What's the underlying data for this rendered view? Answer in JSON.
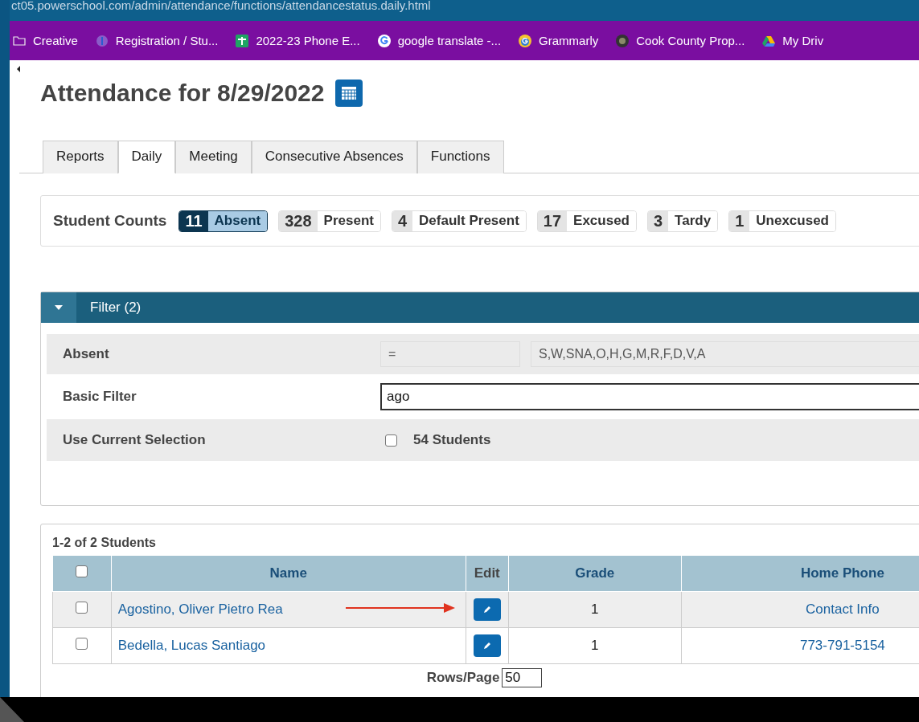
{
  "browser": {
    "url": "ct05.powerschool.com/admin/attendance/functions/attendancestatus.daily.html",
    "bookmarks": [
      {
        "label": "Creative",
        "kind": "folder"
      },
      {
        "label": "Registration / Stu...",
        "kind": "info"
      },
      {
        "label": "2022-23 Phone E...",
        "kind": "sheet"
      },
      {
        "label": "google translate -...",
        "kind": "google"
      },
      {
        "label": "Grammarly",
        "kind": "grammarly"
      },
      {
        "label": "Cook County Prop...",
        "kind": "seal"
      },
      {
        "label": "My Driv",
        "kind": "drive"
      }
    ]
  },
  "page": {
    "title": "Attendance for 8/29/2022",
    "tabs": [
      {
        "label": "Reports",
        "selected": false
      },
      {
        "label": "Daily",
        "selected": true
      },
      {
        "label": "Meeting",
        "selected": false
      },
      {
        "label": "Consecutive Absences",
        "selected": false
      },
      {
        "label": "Functions",
        "selected": false
      }
    ],
    "student_counts": {
      "label": "Student Counts",
      "chips": [
        {
          "count": "11",
          "label": "Absent",
          "selected": true
        },
        {
          "count": "328",
          "label": "Present",
          "selected": false
        },
        {
          "count": "4",
          "label": "Default Present",
          "selected": false
        },
        {
          "count": "17",
          "label": "Excused",
          "selected": false
        },
        {
          "count": "3",
          "label": "Tardy",
          "selected": false
        },
        {
          "count": "1",
          "label": "Unexcused",
          "selected": false
        }
      ]
    },
    "filter": {
      "title": "Filter (2)",
      "expanded": true,
      "rows": [
        {
          "kind": "condition",
          "label": "Absent",
          "operator": "=",
          "value": "S,W,SNA,O,H,G,M,R,F,D,V,A"
        },
        {
          "kind": "text",
          "label": "Basic Filter",
          "value": "ago"
        },
        {
          "kind": "checkbox",
          "label": "Use Current Selection",
          "checked": false,
          "text": "54 Students"
        }
      ]
    },
    "results": {
      "summary": "1-2 of 2 Students",
      "columns": [
        "Name",
        "Edit",
        "Grade",
        "Home Phone"
      ],
      "header_checked": false,
      "rows": [
        {
          "checked": false,
          "name": "Agostino, Oliver Pietro Rea",
          "grade": "1",
          "home_phone": "Contact Info",
          "pointer_arrow": true
        },
        {
          "checked": false,
          "name": "Bedella, Lucas Santiago",
          "grade": "1",
          "home_phone": "773-791-5154",
          "pointer_arrow": false
        }
      ],
      "rows_per_page_label": "Rows/Page",
      "rows_per_page": "50"
    }
  }
}
